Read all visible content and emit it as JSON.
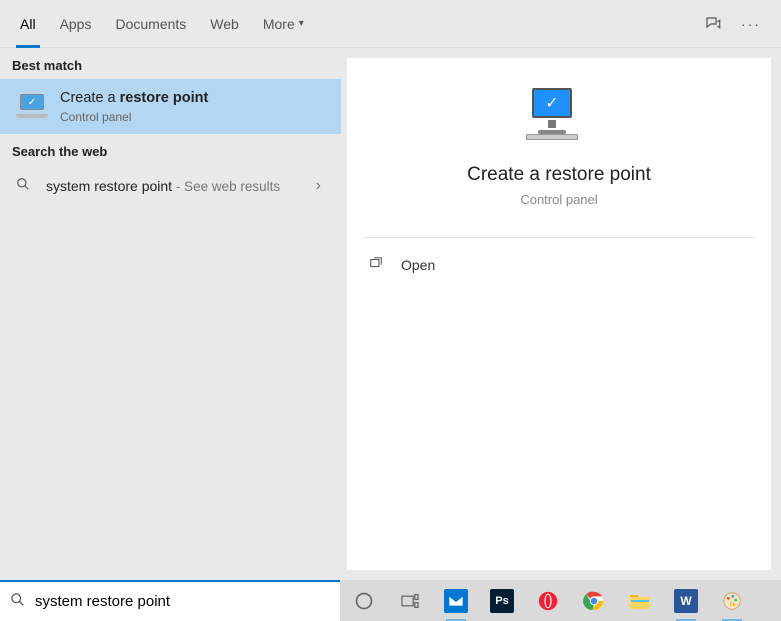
{
  "tabs": {
    "all": "All",
    "apps": "Apps",
    "documents": "Documents",
    "web": "Web",
    "more": "More"
  },
  "sections": {
    "best_match": "Best match",
    "search_web": "Search the web"
  },
  "best_match": {
    "title_prefix": "Create a ",
    "title_bold": "restore point",
    "subtitle": "Control panel"
  },
  "web_result": {
    "query": "system restore point",
    "suffix": " - See web results"
  },
  "preview": {
    "title": "Create a restore point",
    "subtitle": "Control panel",
    "action_open": "Open"
  },
  "search": {
    "value": "system restore point"
  },
  "taskbar": {
    "icons": [
      "cortana",
      "task-view",
      "mail",
      "photoshop",
      "opera",
      "chrome",
      "explorer",
      "word",
      "paint"
    ]
  }
}
